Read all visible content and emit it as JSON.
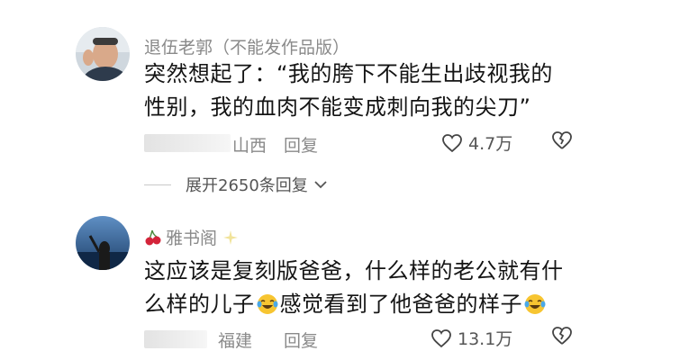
{
  "comments": [
    {
      "username": "退伍老郭（不能发作品版）",
      "text_lines": [
        "突然想起了：“我的胯下不能生出歧视我的",
        "性别，我的血肉不能变成刺向我的尖刀”"
      ],
      "location": "山西",
      "reply_label": "回复",
      "likes": "4.7万"
    },
    {
      "username": "雅书阁",
      "text_line1": "这应该是复刻版爸爸，什么样的老公就有什",
      "text_line2_a": "么样的儿子",
      "text_line2_b": "感觉看到了他爸爸的样子",
      "location": "福建",
      "reply_label": "回复",
      "likes": "13.1万"
    }
  ],
  "expand_replies_label": "展开2650条回复",
  "icons": {
    "heart": "heart-outline",
    "dislike": "broken-heart-outline",
    "expand_chevron": "chevron-down",
    "emoji": "laughing-tears"
  },
  "colors": {
    "text": "#141414",
    "meta": "#8a8a8a",
    "emoji_face": "#f7c531"
  }
}
